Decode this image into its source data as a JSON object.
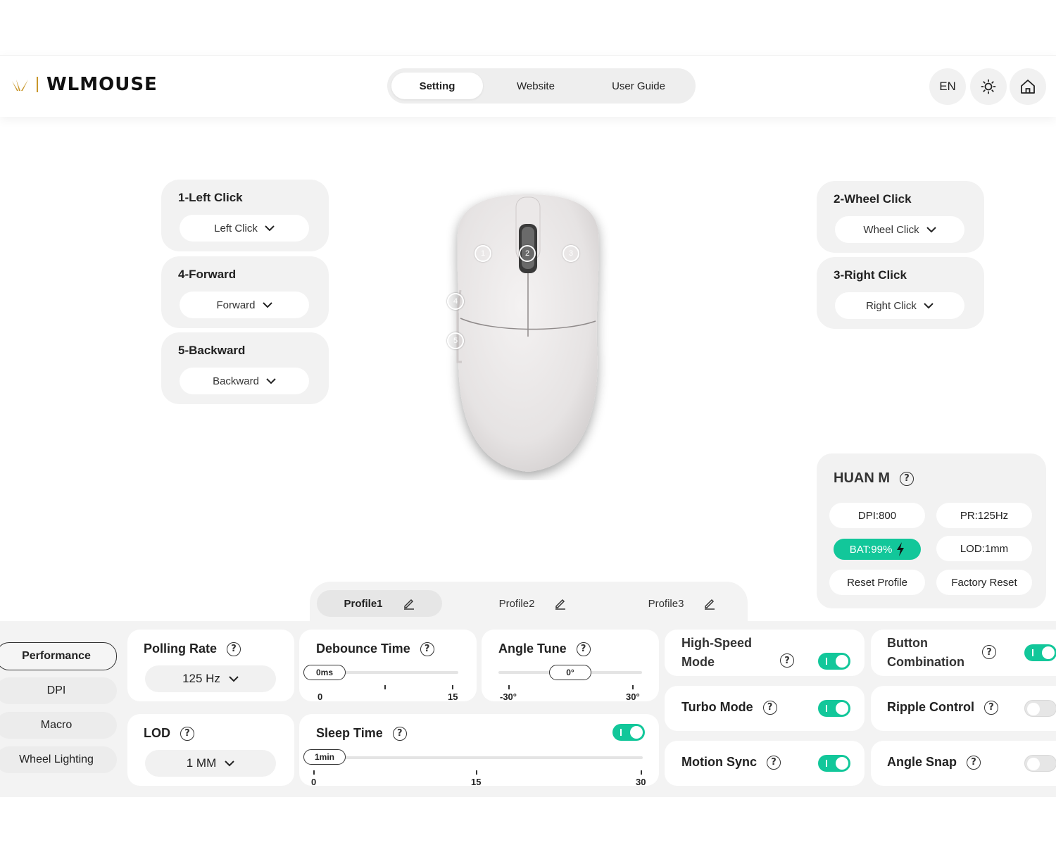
{
  "header": {
    "brand": "WLMOUSE",
    "tabs": [
      "Setting",
      "Website",
      "User Guide"
    ],
    "language": "EN"
  },
  "buttons": {
    "b1": {
      "title": "1-Left Click",
      "value": "Left Click"
    },
    "b4": {
      "title": "4-Forward",
      "value": "Forward"
    },
    "b5": {
      "title": "5-Backward",
      "value": "Backward"
    },
    "b2": {
      "title": "2-Wheel Click",
      "value": "Wheel Click"
    },
    "b3": {
      "title": "3-Right Click",
      "value": "Right Click"
    }
  },
  "mouse": {
    "markers": [
      "1",
      "2",
      "3",
      "4",
      "5"
    ]
  },
  "device": {
    "name": "HUAN M",
    "dpi": "DPI:800",
    "pr": "PR:125Hz",
    "battery": "BAT:99%",
    "lod": "LOD:1mm",
    "reset": "Reset Profile",
    "factory": "Factory Reset"
  },
  "profiles": [
    "Profile1",
    "Profile2",
    "Profile3"
  ],
  "sidebar": [
    "Performance",
    "DPI",
    "Macro",
    "Wheel Lighting"
  ],
  "performance": {
    "polling": {
      "title": "Polling Rate",
      "value": "125 Hz"
    },
    "lod": {
      "title": "LOD",
      "value": "1 MM"
    },
    "debounce": {
      "title": "Debounce Time",
      "value": "0ms",
      "min": "0",
      "max": "15"
    },
    "angle": {
      "title": "Angle Tune",
      "value": "0°",
      "min": "-30°",
      "max": "30°"
    },
    "sleep": {
      "title": "Sleep Time",
      "value": "1min",
      "min": "0",
      "mid": "15",
      "max": "30",
      "enabled": true
    },
    "features": {
      "high_speed": {
        "title_line1": "High-Speed",
        "title_line2": "Mode",
        "on": true
      },
      "button_combo": {
        "title_line1": "Button",
        "title_line2": "Combination",
        "on": true
      },
      "turbo": {
        "title": "Turbo Mode",
        "on": true
      },
      "ripple": {
        "title": "Ripple Control",
        "on": false
      },
      "motion_sync": {
        "title": "Motion Sync",
        "on": true
      },
      "angle_snap": {
        "title": "Angle Snap",
        "on": false
      }
    }
  },
  "colors": {
    "accent": "#12c79a",
    "brand_gold": "#c8962a"
  }
}
